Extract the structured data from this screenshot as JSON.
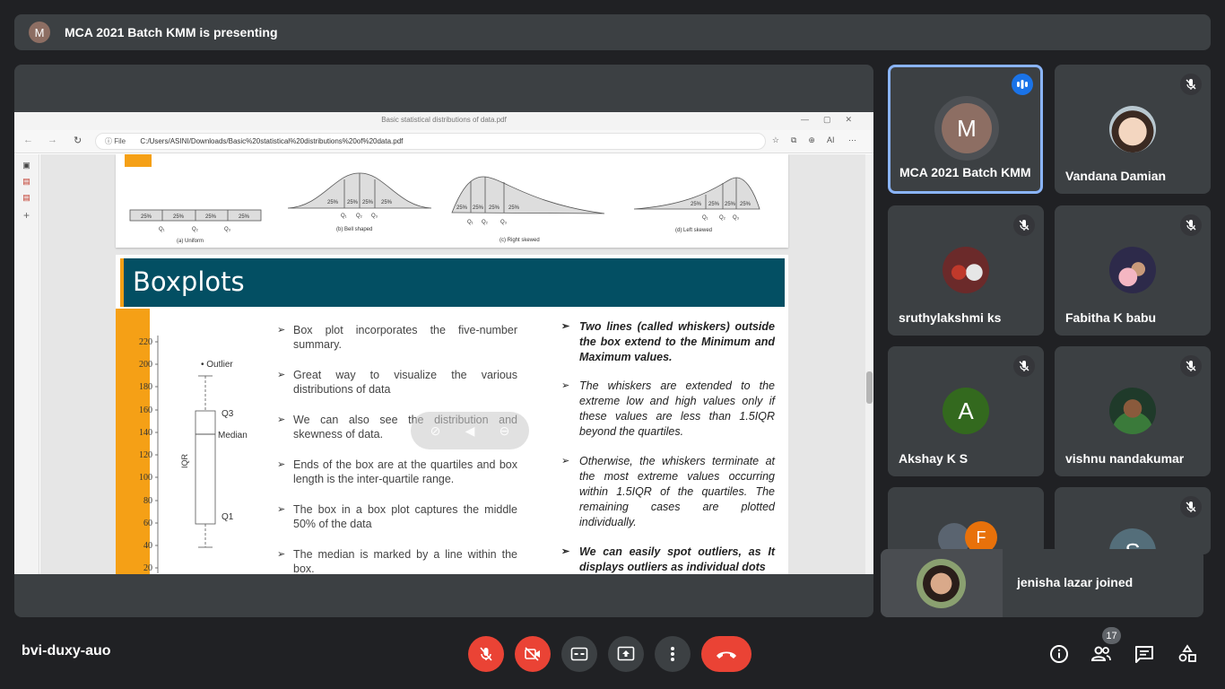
{
  "banner": {
    "avatar_letter": "M",
    "text": "MCA 2021 Batch KMM is presenting"
  },
  "browser": {
    "tab_title": "Basic statistical distributions of data.pdf",
    "url_label": "File",
    "url": "C:/Users/ASINI/Downloads/Basic%20statistical%20distributions%20of%20data.pdf",
    "ai_label": "AI"
  },
  "distribution_figure": {
    "quarter_label": "25%",
    "uniform": {
      "q1": "Q₁",
      "q2": "Q₂",
      "q3": "Q₃",
      "caption": "(a) Uniform"
    },
    "bell": {
      "q1": "Q₁",
      "q2": "Q₂",
      "q3": "Q₃",
      "caption": "(b) Bell shaped"
    },
    "right": {
      "q1": "Q₁",
      "q2": "Q₂",
      "q3": "Q₃",
      "caption": "(c) Right skewed"
    },
    "left": {
      "q1": "Q₁",
      "q2": "Q₂",
      "q3": "Q₃",
      "caption": "(d) Left skewed"
    }
  },
  "slide": {
    "title": "Boxplots",
    "boxplot": {
      "y_ticks": [
        "220",
        "200",
        "180",
        "160",
        "140",
        "120",
        "100",
        "80",
        "60",
        "40",
        "20"
      ],
      "outlier_label": "• Outlier",
      "q3_label": "Q3",
      "median_label": "Median",
      "q1_label": "Q1",
      "iqr_label": "IQR"
    },
    "bullets": [
      "Box plot incorporates the five-number summary.",
      "Great way to visualize the various distributions of data",
      "We can also see the distribution and skewness of data.",
      "Ends of the box are at the quartiles and box length is the inter-quartile range.",
      "The box in a box plot captures the middle 50% of the data",
      "The median is marked by a line within the box."
    ],
    "right_bullets": [
      "Two lines (called whiskers) outside the box extend to the Minimum and Maximum values.",
      "The whiskers are extended to the extreme low and high values only if these values are less than 1.5IQR beyond the quartiles.",
      "Otherwise, the whiskers terminate at the most extreme values occurring within 1.5IQR of the quartiles. The remaining cases are plotted individually.",
      "We can easily spot outliers, as It displays outliers as individual dots"
    ]
  },
  "participants": [
    {
      "name": "MCA 2021 Batch KMM",
      "letter": "M"
    },
    {
      "name": "Vandana Damian"
    },
    {
      "name": "sruthylakshmi ks"
    },
    {
      "name": "Fabitha K babu"
    },
    {
      "name": "Akshay K S",
      "letter": "A"
    },
    {
      "name": "vishnu nandakumar"
    },
    {
      "letter": "F"
    },
    {
      "letter": "S"
    }
  ],
  "toast": {
    "text": "jenisha lazar joined"
  },
  "bottom": {
    "meeting_code": "bvi-duxy-auo",
    "people_count": "17"
  },
  "colors": {
    "red": "#ea4335",
    "teal": "#034f63",
    "orange": "#f5a016",
    "speaking_blue": "#1a73e8"
  }
}
